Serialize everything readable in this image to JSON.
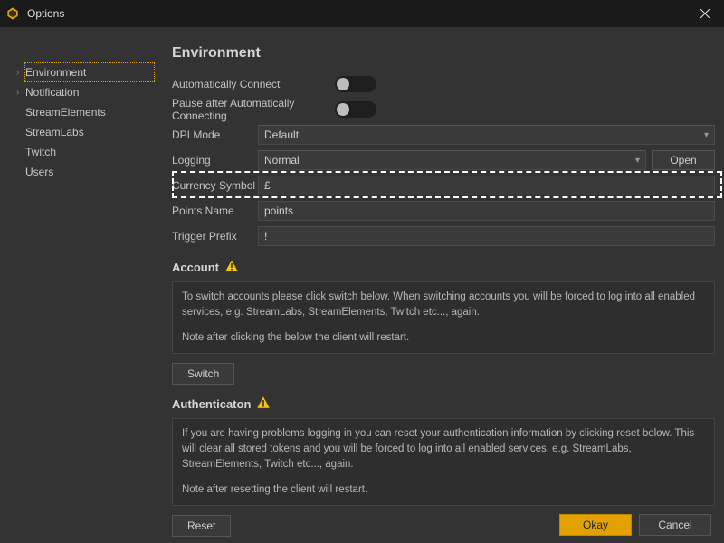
{
  "window": {
    "title": "Options"
  },
  "sidebar": {
    "items": [
      {
        "label": "Environment",
        "expandable": true,
        "selected": true
      },
      {
        "label": "Notification",
        "expandable": true,
        "selected": false
      },
      {
        "label": "StreamElements",
        "expandable": false,
        "selected": false
      },
      {
        "label": "StreamLabs",
        "expandable": false,
        "selected": false
      },
      {
        "label": "Twitch",
        "expandable": false,
        "selected": false
      },
      {
        "label": "Users",
        "expandable": false,
        "selected": false
      }
    ]
  },
  "main": {
    "title": "Environment",
    "auto_connect_label": "Automatically Connect",
    "auto_connect": false,
    "pause_after_label": "Pause after Automatically Connecting",
    "pause_after": false,
    "dpi_mode_label": "DPI Mode",
    "dpi_mode_value": "Default",
    "logging_label": "Logging",
    "logging_value": "Normal",
    "logging_open_label": "Open",
    "currency_symbol_label": "Currency Symbol",
    "currency_symbol_value": "£",
    "points_name_label": "Points Name",
    "points_name_value": "points",
    "trigger_prefix_label": "Trigger Prefix",
    "trigger_prefix_value": "!",
    "account_header": "Account",
    "account_text1": "To switch accounts please click switch below. When switching accounts you will be forced to log into all enabled services, e.g. StreamLabs, StreamElements, Twitch etc..., again.",
    "account_text2": "Note after clicking the below the client will restart.",
    "switch_label": "Switch",
    "auth_header": "Authenticaton",
    "auth_text1": "If you are having problems logging in you can reset your authentication information by clicking reset below. This will clear all stored tokens and you will be forced to log into all enabled services, e.g. StreamLabs, StreamElements, Twitch etc..., again.",
    "auth_text2": "Note after resetting the client will restart.",
    "reset_label": "Reset"
  },
  "footer": {
    "okay": "Okay",
    "cancel": "Cancel"
  }
}
